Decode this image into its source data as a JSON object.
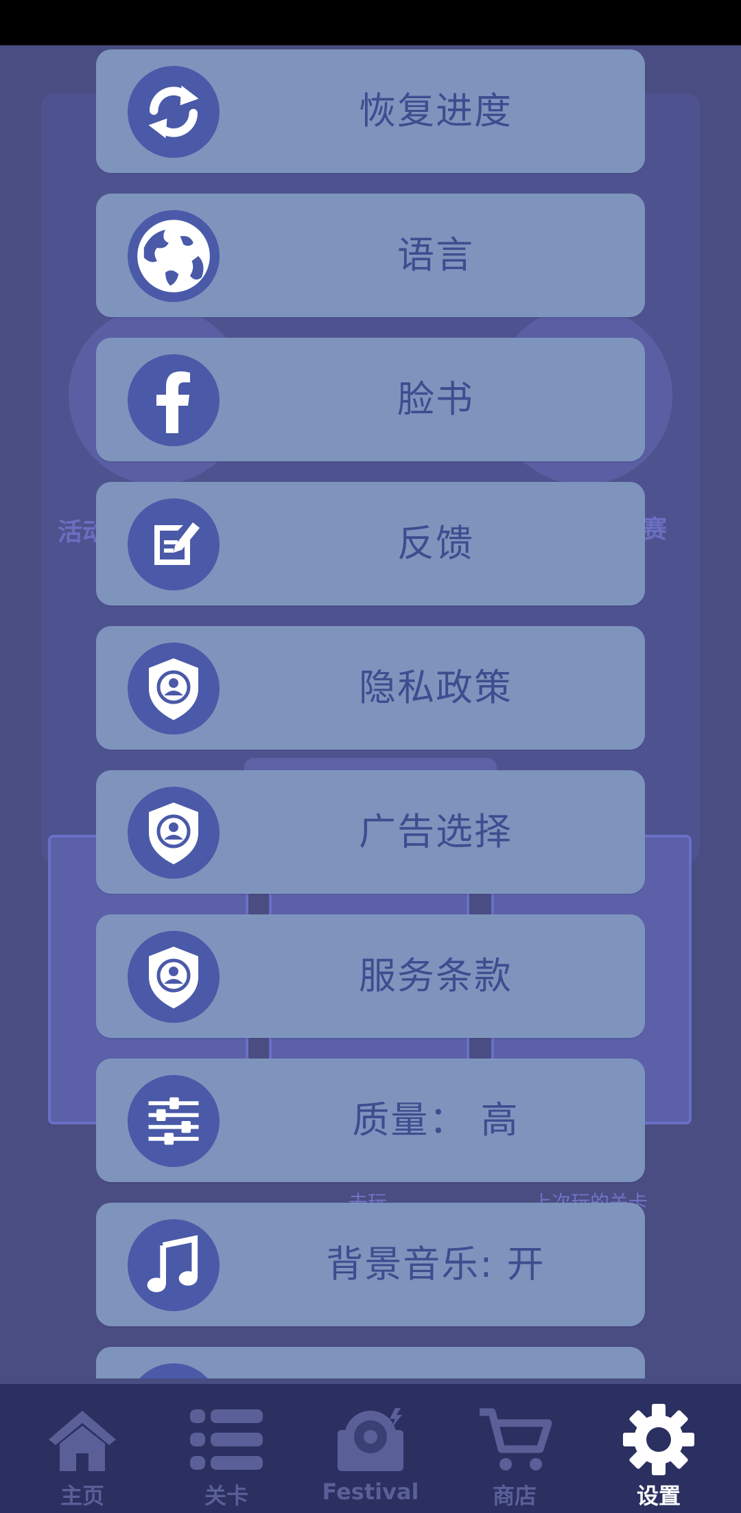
{
  "background": {
    "left_label": "活动",
    "right_label": "周赛",
    "play_button": "去玩",
    "card_captions": [
      "去玩",
      "上次玩的关卡"
    ]
  },
  "settings": {
    "items": [
      {
        "label": "恢复进度",
        "icon": "sync-icon"
      },
      {
        "label": "语言",
        "icon": "globe-icon"
      },
      {
        "label": "脸书",
        "icon": "facebook-icon"
      },
      {
        "label": "反馈",
        "icon": "feedback-icon"
      },
      {
        "label": "隐私政策",
        "icon": "shield-user-icon"
      },
      {
        "label": "广告选择",
        "icon": "shield-user-icon"
      },
      {
        "label": "服务条款",
        "icon": "shield-user-icon"
      },
      {
        "label": "质量：  高",
        "icon": "sliders-icon"
      },
      {
        "label": "背景音乐: 开",
        "icon": "music-note-icon"
      }
    ]
  },
  "nav": {
    "items": [
      {
        "label": "主页",
        "icon": "home-icon",
        "active": false
      },
      {
        "label": "关卡",
        "icon": "list-icon",
        "active": false
      },
      {
        "label": "Festival",
        "icon": "record-icon",
        "active": false
      },
      {
        "label": "商店",
        "icon": "cart-icon",
        "active": false
      },
      {
        "label": "设置",
        "icon": "gear-icon",
        "active": true
      }
    ]
  },
  "colors": {
    "background": "#4a4d82",
    "item_bg": "#7e94bd",
    "icon_circle": "#4a5aa8",
    "item_text": "#3d4d8f",
    "nav_bg": "#2b3060",
    "nav_inactive": "#5a5f98",
    "nav_active": "#ffffff"
  }
}
